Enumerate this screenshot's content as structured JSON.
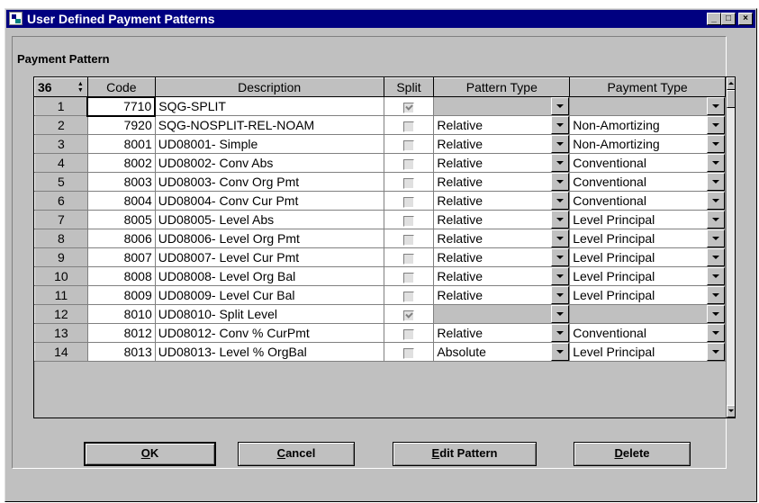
{
  "window": {
    "title": "User Defined Payment Patterns",
    "controls": {
      "minimize": "_",
      "maximize": "□",
      "close": "×"
    }
  },
  "panel": {
    "title": "Payment Pattern"
  },
  "grid": {
    "record_count": "36",
    "columns": [
      "Code",
      "Description",
      "Split",
      "Pattern Type",
      "Payment Type"
    ],
    "rows": [
      {
        "num": "1",
        "code": "7710",
        "description": "SQG-SPLIT",
        "split": true,
        "pattern_type": "",
        "payment_type": ""
      },
      {
        "num": "2",
        "code": "7920",
        "description": "SQG-NOSPLIT-REL-NOAM",
        "split": false,
        "pattern_type": "Relative",
        "payment_type": "Non-Amortizing"
      },
      {
        "num": "3",
        "code": "8001",
        "description": "UD08001- Simple",
        "split": false,
        "pattern_type": "Relative",
        "payment_type": "Non-Amortizing"
      },
      {
        "num": "4",
        "code": "8002",
        "description": "UD08002- Conv Abs",
        "split": false,
        "pattern_type": "Relative",
        "payment_type": "Conventional"
      },
      {
        "num": "5",
        "code": "8003",
        "description": "UD08003- Conv Org Pmt",
        "split": false,
        "pattern_type": "Relative",
        "payment_type": "Conventional"
      },
      {
        "num": "6",
        "code": "8004",
        "description": "UD08004- Conv  Cur Pmt",
        "split": false,
        "pattern_type": "Relative",
        "payment_type": "Conventional"
      },
      {
        "num": "7",
        "code": "8005",
        "description": "UD08005- Level Abs",
        "split": false,
        "pattern_type": "Relative",
        "payment_type": "Level Principal"
      },
      {
        "num": "8",
        "code": "8006",
        "description": "UD08006- Level Org Pmt",
        "split": false,
        "pattern_type": "Relative",
        "payment_type": "Level Principal"
      },
      {
        "num": "9",
        "code": "8007",
        "description": "UD08007- Level Cur Pmt",
        "split": false,
        "pattern_type": "Relative",
        "payment_type": "Level Principal"
      },
      {
        "num": "10",
        "code": "8008",
        "description": "UD08008- Level Org Bal",
        "split": false,
        "pattern_type": "Relative",
        "payment_type": "Level Principal"
      },
      {
        "num": "11",
        "code": "8009",
        "description": "UD08009- Level Cur Bal",
        "split": false,
        "pattern_type": "Relative",
        "payment_type": "Level Principal"
      },
      {
        "num": "12",
        "code": "8010",
        "description": "UD08010- Split Level",
        "split": true,
        "pattern_type": "",
        "payment_type": ""
      },
      {
        "num": "13",
        "code": "8012",
        "description": "UD08012- Conv % CurPmt",
        "split": false,
        "pattern_type": "Relative",
        "payment_type": "Conventional"
      },
      {
        "num": "14",
        "code": "8013",
        "description": "UD08013- Level % OrgBal",
        "split": false,
        "pattern_type": "Absolute",
        "payment_type": "Level Principal"
      }
    ]
  },
  "buttons": {
    "ok": {
      "mnemonic": "O",
      "rest": "K"
    },
    "cancel": {
      "mnemonic": "C",
      "rest": "ancel"
    },
    "edit_pattern": {
      "mnemonic": "E",
      "rest": "dit Pattern"
    },
    "delete": {
      "mnemonic": "D",
      "rest": "elete"
    }
  },
  "icons": {
    "app": "app-icon",
    "record-spinner": "spinner-icon",
    "dropdown": "chevron-down-icon",
    "checkbox": "checkbox-icon"
  }
}
